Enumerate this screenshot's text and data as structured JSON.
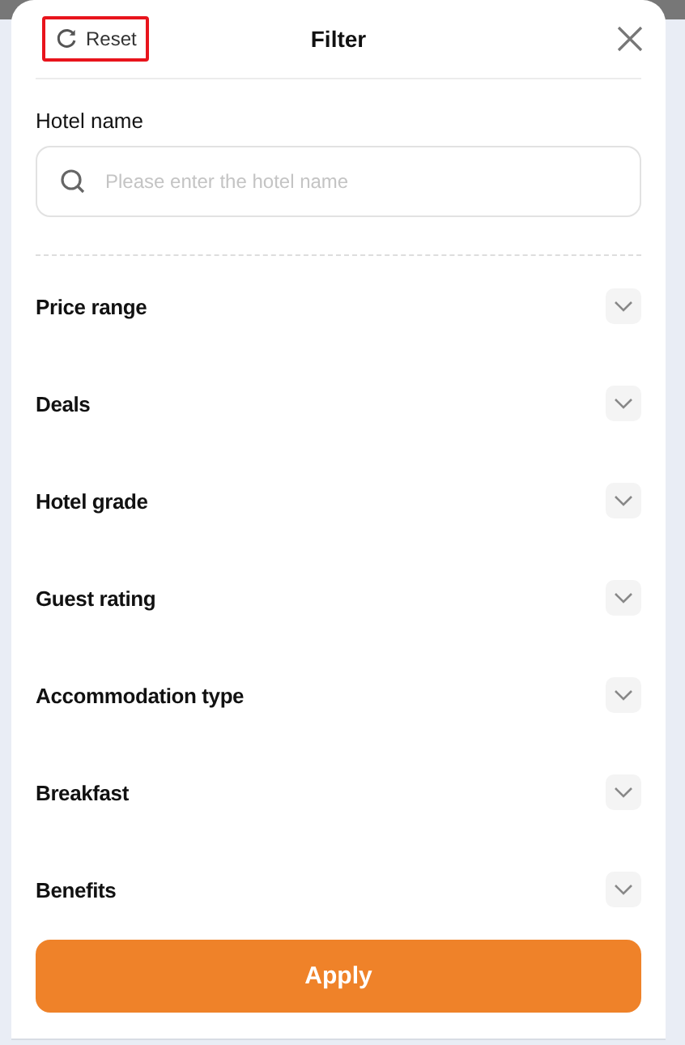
{
  "header": {
    "reset": {
      "label": "Reset",
      "highlighted": true
    },
    "title": "Filter"
  },
  "hotel_name": {
    "label": "Hotel name",
    "placeholder": "Please enter the hotel name"
  },
  "sections": [
    {
      "label": "Price range",
      "expanded": false
    },
    {
      "label": "Deals",
      "expanded": false
    },
    {
      "label": "Hotel grade",
      "expanded": false
    },
    {
      "label": "Guest rating",
      "expanded": false
    },
    {
      "label": "Accommodation type",
      "expanded": false
    },
    {
      "label": "Breakfast",
      "expanded": false
    },
    {
      "label": "Benefits",
      "expanded": false
    }
  ],
  "apply_button": "Apply"
}
